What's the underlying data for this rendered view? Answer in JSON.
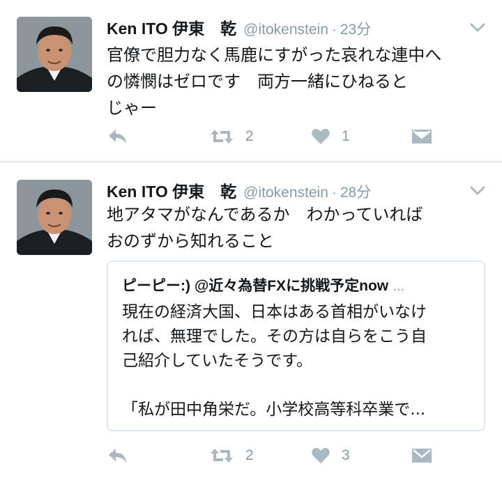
{
  "tweets": [
    {
      "author_name": "Ken ITO 伊東　乾",
      "handle": "@itokenstein",
      "separator": "·",
      "time": "23分",
      "text_lines": [
        "官僚で胆力なく馬鹿にすがった哀れな連中へ",
        "の憐憫はゼロです　両方一緒にひねると",
        "じゃー"
      ],
      "retweet_count": "2",
      "like_count": "1"
    },
    {
      "author_name": "Ken ITO 伊東　乾",
      "handle": "@itokenstein",
      "separator": "·",
      "time": "28分",
      "text_lines": [
        "地アタマがなんであるか　わかっていれば",
        "おのずから知れること"
      ],
      "quoted": {
        "header": "ピーピー:) @近々為替FXに挑戦予定now",
        "ellipsis": "...",
        "body_lines": [
          "現在の経済大国、日本はある首相がいなけ",
          "れば、無理でした。その方は自らをこう自",
          "己紹介していたそうです。"
        ],
        "last_line": "「私が田中角栄だ。小学校高等科卒業で..."
      },
      "retweet_count": "2",
      "like_count": "3"
    }
  ],
  "icons": {
    "reply": "reply-icon",
    "retweet": "retweet-icon",
    "like": "heart-icon",
    "dm": "envelope-icon",
    "menu": "chevron-down-icon"
  },
  "colors": {
    "icon_gray": "#aab8c2",
    "meta_gray": "#8899a6",
    "divider": "#e1e8ed"
  }
}
